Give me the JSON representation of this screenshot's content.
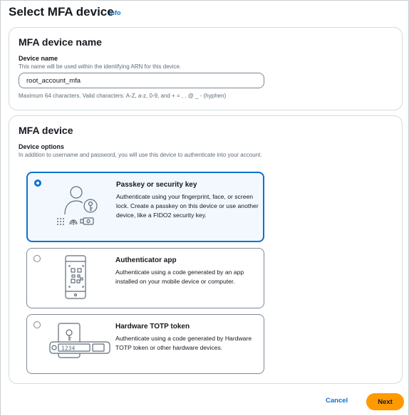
{
  "header": {
    "title": "Select MFA device",
    "info_link": "Info"
  },
  "device_name_section": {
    "title": "MFA device name",
    "field_label": "Device name",
    "field_description": "This name will be used within the identifying ARN for this device.",
    "field_value": "root_account_mfa",
    "field_constraint": "Maximum 64 characters. Valid characters: A-Z, a-z, 0-9, and + = , . @ _ - (hyphen)"
  },
  "device_section": {
    "title": "MFA device",
    "options_label": "Device options",
    "options_description": "In addition to username and password, you will use this device to authenticate into your account.",
    "options": [
      {
        "title": "Passkey or security key",
        "description": "Authenticate using your fingerprint, face, or screen lock. Create a passkey on this device or use another device, like a FIDO2 security key.",
        "selected": true,
        "icon": "passkey-user-key-icon"
      },
      {
        "title": "Authenticator app",
        "description": "Authenticate using a code generated by an app installed on your mobile device or computer.",
        "selected": false,
        "icon": "mobile-qr-code-icon"
      },
      {
        "title": "Hardware TOTP token",
        "description": "Authenticate using a code generated by Hardware TOTP token or other hardware devices.",
        "selected": false,
        "icon": "hardware-token-icon",
        "token_display": "1234"
      }
    ]
  },
  "footer": {
    "cancel_label": "Cancel",
    "next_label": "Next"
  },
  "colors": {
    "accent": "#0972d3",
    "primary_button": "#ff9900"
  }
}
